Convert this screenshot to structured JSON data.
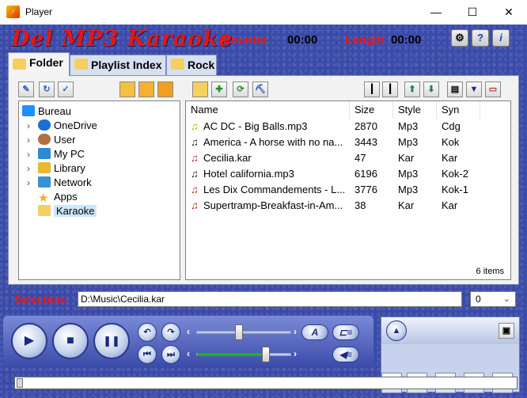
{
  "window": {
    "title": "Player",
    "minimize": "—",
    "maximize": "☐",
    "close": "✕"
  },
  "header": {
    "logo": "Del MP3 Karaoke",
    "counter_label": "Counter",
    "counter_value": "00:00",
    "length_label": "Length",
    "length_value": "00:00",
    "buttons": [
      "⚙",
      "?",
      "i"
    ]
  },
  "tabs": [
    {
      "label": "Folder",
      "active": true
    },
    {
      "label": "Playlist Index",
      "active": false
    },
    {
      "label": "Rock",
      "active": false
    }
  ],
  "tree": {
    "items": [
      {
        "label": "Bureau",
        "icon": "desktop-icon",
        "color": "#1e90ff"
      },
      {
        "label": "OneDrive",
        "icon": "cloud-icon",
        "color": "#1a6fd4"
      },
      {
        "label": "User",
        "icon": "user-icon",
        "color": "#b07040"
      },
      {
        "label": "My PC",
        "icon": "computer-icon",
        "color": "#2a8ad4"
      },
      {
        "label": "Library",
        "icon": "library-icon",
        "color": "#e8b830"
      },
      {
        "label": "Network",
        "icon": "network-icon",
        "color": "#3a90d0"
      },
      {
        "label": "Apps",
        "icon": "star-icon",
        "color": "#f0b020"
      },
      {
        "label": "Karaoke",
        "icon": "folder-icon",
        "color": "#f5d060",
        "selected": true
      }
    ]
  },
  "filelist": {
    "columns": [
      "Name",
      "Size",
      "Style",
      "Syn"
    ],
    "rows": [
      {
        "name": "AC DC - Big Balls.mp3",
        "size": "2870",
        "style": "Mp3",
        "syn": "Cdg",
        "note_color": "#c8a000"
      },
      {
        "name": "America - A horse with no na...",
        "size": "3443",
        "style": "Mp3",
        "syn": "Kok",
        "note_color": "#202020"
      },
      {
        "name": "Cecilia.kar",
        "size": "47",
        "style": "Kar",
        "syn": "Kar",
        "note_color": "#c02020"
      },
      {
        "name": "Hotel california.mp3",
        "size": "6196",
        "style": "Mp3",
        "syn": "Kok-2",
        "note_color": "#202020"
      },
      {
        "name": "Les Dix Commandements - L...",
        "size": "3776",
        "style": "Mp3",
        "syn": "Kok-1",
        "note_color": "#c02020"
      },
      {
        "name": "Supertramp-Breakfast-in-Am...",
        "size": "38",
        "style": "Kar",
        "syn": "Kar",
        "note_color": "#c02020"
      }
    ],
    "count": "6 items"
  },
  "selection": {
    "label": "Selection:",
    "value": "D:\\Music\\Cecilia.kar",
    "combo_value": "0"
  },
  "transport": {
    "play": "▶",
    "stop": "■",
    "pause": "❚❚",
    "rewind": "↶",
    "forward": "↷",
    "prev": "⏮",
    "next": "⏭",
    "pitch_label": "A",
    "tempo_level": 0.45,
    "volume_level": 0.73
  },
  "colors": {
    "frame": "#3a4aa8",
    "accent_red": "#e81818",
    "volume_green": "#22b022"
  }
}
